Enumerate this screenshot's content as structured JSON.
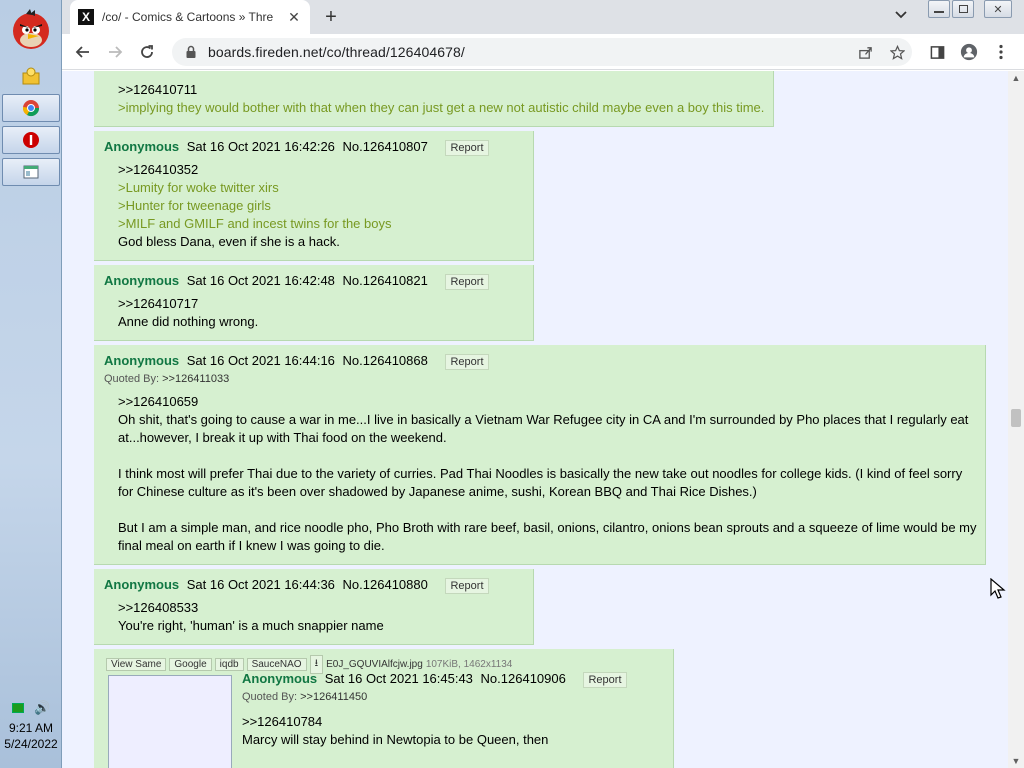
{
  "browser": {
    "tab_title": "/co/ - Comics & Cartoons » Thre",
    "tab_favicon": "X",
    "url": "boards.fireden.net/co/thread/126404678/"
  },
  "taskbar": {
    "clock_time": "9:21 AM",
    "clock_date": "5/24/2022"
  },
  "posts": [
    {
      "lines": [
        {
          "text": ">>126410711",
          "type": "qlink"
        },
        {
          "text": ">implying they would bother with that when they can just get a new not autistic child maybe even a boy this time.",
          "type": "green"
        }
      ]
    },
    {
      "name": "Anonymous",
      "date": "Sat 16 Oct 2021 16:42:26",
      "no": "No.126410807",
      "report": "Report",
      "lines": [
        {
          "text": ">>126410352",
          "type": "qlink"
        },
        {
          "text": ">Lumity for woke twitter xirs",
          "type": "green"
        },
        {
          "text": ">Hunter for tweenage girls",
          "type": "green"
        },
        {
          "text": ">MILF and GMILF and incest twins for the boys",
          "type": "green"
        },
        {
          "text": "God bless Dana, even if she is a hack.",
          "type": "text"
        }
      ]
    },
    {
      "name": "Anonymous",
      "date": "Sat 16 Oct 2021 16:42:48",
      "no": "No.126410821",
      "report": "Report",
      "lines": [
        {
          "text": ">>126410717",
          "type": "qlink"
        },
        {
          "text": "Anne did nothing wrong.",
          "type": "text"
        }
      ]
    },
    {
      "name": "Anonymous",
      "date": "Sat 16 Oct 2021 16:44:16",
      "no": "No.126410868",
      "report": "Report",
      "quoted_by_label": "Quoted By:",
      "quoted_by": ">>126411033",
      "lines": [
        {
          "text": ">>126410659",
          "type": "qlink"
        },
        {
          "text": "Oh shit, that's going to cause a war in me...I live in basically a Vietnam War Refugee city in CA and I'm surrounded by Pho places that I regularly eat at...however, I break it up with Thai food on the weekend.",
          "type": "text"
        },
        {
          "text": "I think most will prefer Thai due to the variety of curries. Pad Thai Noodles is basically the new take out noodles for college kids. (I kind of feel sorry for Chinese culture as it's been over shadowed by Japanese anime, sushi, Korean BBQ and Thai Rice Dishes.)",
          "type": "text"
        },
        {
          "text": "But I am a simple man, and rice noodle pho, Pho Broth with rare beef, basil, onions, cilantro, onions bean sprouts and a squeeze of lime would be my final meal on earth if I knew I was going to die.",
          "type": "text"
        }
      ]
    },
    {
      "name": "Anonymous",
      "date": "Sat 16 Oct 2021 16:44:36",
      "no": "No.126410880",
      "report": "Report",
      "lines": [
        {
          "text": ">>126408533",
          "type": "qlink"
        },
        {
          "text": "You're right, 'human' is a much snappier name",
          "type": "text"
        }
      ]
    },
    {
      "name": "Anonymous",
      "date": "Sat 16 Oct 2021 16:45:43",
      "no": "No.126410906",
      "report": "Report",
      "quoted_by_label": "Quoted By:",
      "quoted_by": ">>126411450",
      "file_buttons": [
        "View Same",
        "Google",
        "iqdb",
        "SauceNAO"
      ],
      "file_name": "E0J_GQUVIAlfcjw.jpg",
      "file_meta": "107KiB, 1462x1134",
      "lines": [
        {
          "text": ">>126410784",
          "type": "qlink"
        },
        {
          "text": "Marcy will stay behind in Newtopia to be Queen, then",
          "type": "text"
        }
      ]
    }
  ],
  "icons": {
    "start": "angry-bird-start-icon",
    "back": "back-arrow-icon",
    "forward": "forward-arrow-icon",
    "reload": "reload-icon",
    "lock": "lock-icon",
    "share": "share-icon",
    "star": "bookmark-star-icon",
    "sidepanel": "side-panel-icon",
    "profile": "profile-icon",
    "menu": "kebab-menu-icon"
  },
  "colors": {
    "post_bg": "#d6f0d0",
    "name": "#117743",
    "greentext": "#789922"
  }
}
